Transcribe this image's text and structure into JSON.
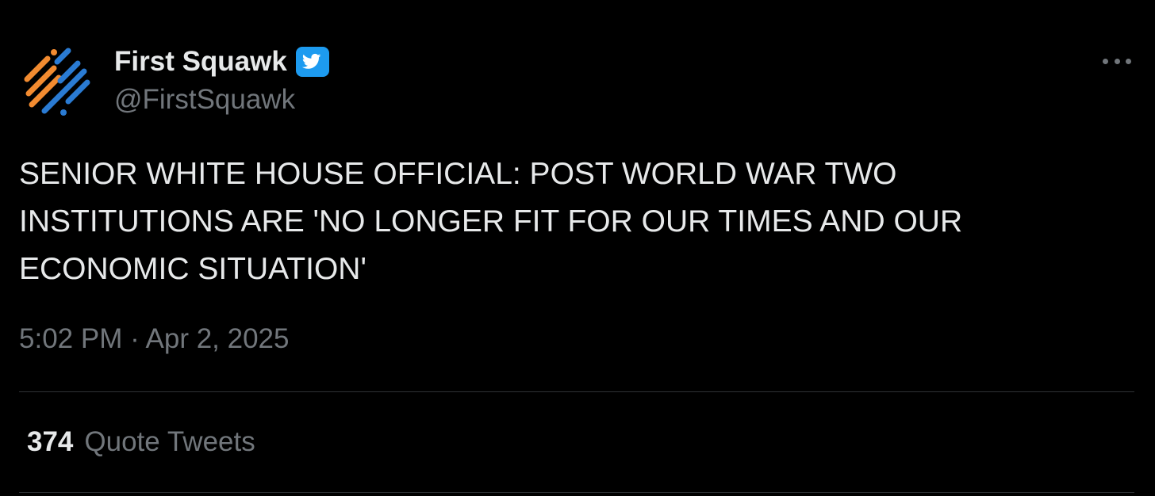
{
  "tweet": {
    "author": {
      "display_name": "First Squawk",
      "handle": "@FirstSquawk",
      "verified_icon": "verified-badge-icon",
      "avatar_icon": "first-squawk-logo-icon"
    },
    "more_icon": "more-options-icon",
    "text": "SENIOR WHITE HOUSE OFFICIAL: POST WORLD WAR TWO\nINSTITUTIONS ARE 'NO LONGER FIT FOR OUR TIMES AND OUR\nECONOMIC SITUATION'",
    "timestamp": "5:02 PM · Apr 2, 2025",
    "stats": {
      "quote_count": "374",
      "quote_label": "Quote Tweets"
    }
  },
  "colors": {
    "background": "#000000",
    "primary_text": "#e7e9ea",
    "secondary_text": "#71767b",
    "divider": "#2f3336",
    "verified_blue": "#1d9bf0",
    "logo_orange": "#f28b30",
    "logo_blue": "#2a7bd3"
  }
}
